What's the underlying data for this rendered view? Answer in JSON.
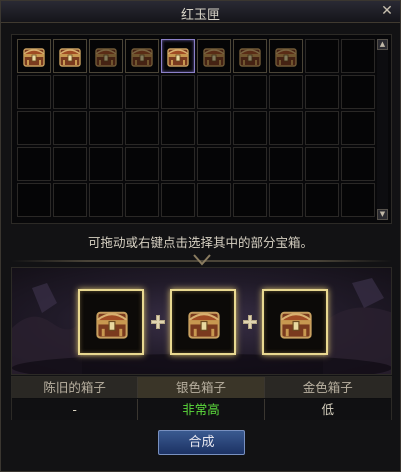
{
  "window": {
    "title": "红玉匣"
  },
  "inventory": {
    "slots": [
      {
        "item": "chest-icon",
        "state": "normal"
      },
      {
        "item": "chest-icon",
        "state": "normal"
      },
      {
        "item": "chest-icon",
        "state": "dim"
      },
      {
        "item": "chest-icon",
        "state": "dim"
      },
      {
        "item": "chest-icon",
        "state": "selected"
      },
      {
        "item": "chest-icon",
        "state": "dim"
      },
      {
        "item": "chest-icon",
        "state": "dim"
      },
      {
        "item": "chest-icon",
        "state": "dim"
      }
    ],
    "rows": 5,
    "columns": 10
  },
  "hint": "可拖动或右键点击选择其中的部分宝箱。",
  "combination": {
    "slots": [
      "chest-icon",
      "chest-icon",
      "chest-icon"
    ],
    "operator_icon": "plus-icon"
  },
  "table": {
    "headers": [
      "陈旧的箱子",
      "银色箱子",
      "金色箱子"
    ],
    "values": [
      "-",
      "非常高",
      "低"
    ]
  },
  "button": {
    "label": "合成"
  },
  "colors": {
    "accent_green": "#5cdc3c",
    "slot_glow": "#e8d890",
    "button_blue": "#2a4a80"
  }
}
